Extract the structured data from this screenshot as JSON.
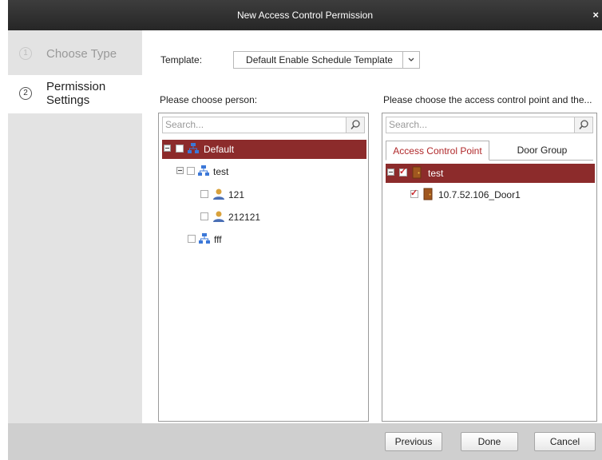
{
  "window": {
    "title": "New Access Control Permission",
    "close_glyph": "×"
  },
  "steps": [
    {
      "number": "1",
      "label": "Choose Type"
    },
    {
      "number": "2",
      "label_line1": "Permission",
      "label_line2": "Settings"
    }
  ],
  "template": {
    "label": "Template:",
    "value": "Default Enable Schedule Template"
  },
  "person_panel": {
    "label": "Please choose person:",
    "search_placeholder": "Search...",
    "tree": [
      {
        "label": "Default",
        "type": "group",
        "selected": true,
        "checked": false
      },
      {
        "label": "test",
        "type": "group",
        "checked": false
      },
      {
        "label": "121",
        "type": "person",
        "checked": false
      },
      {
        "label": "212121",
        "type": "person",
        "checked": false
      },
      {
        "label": "fff",
        "type": "group",
        "checked": false
      }
    ]
  },
  "access_panel": {
    "label": "Please choose the access control point and the...",
    "search_placeholder": "Search...",
    "tabs": [
      "Access Control Point",
      "Door Group"
    ],
    "active_tab": "Access Control Point",
    "tree": [
      {
        "label": "test",
        "type": "device",
        "selected": true,
        "checked": true
      },
      {
        "label": "10.7.52.106_Door1",
        "type": "door",
        "checked": true
      }
    ]
  },
  "buttons": {
    "previous": "Previous",
    "done": "Done",
    "cancel": "Cancel"
  },
  "colors": {
    "title_bar": "#2e2e2e",
    "selected_row": "#8c2b2b",
    "active_tab_text": "#b0282a",
    "sidebar": "#e3e3e3",
    "footer": "#cfcfcf"
  }
}
